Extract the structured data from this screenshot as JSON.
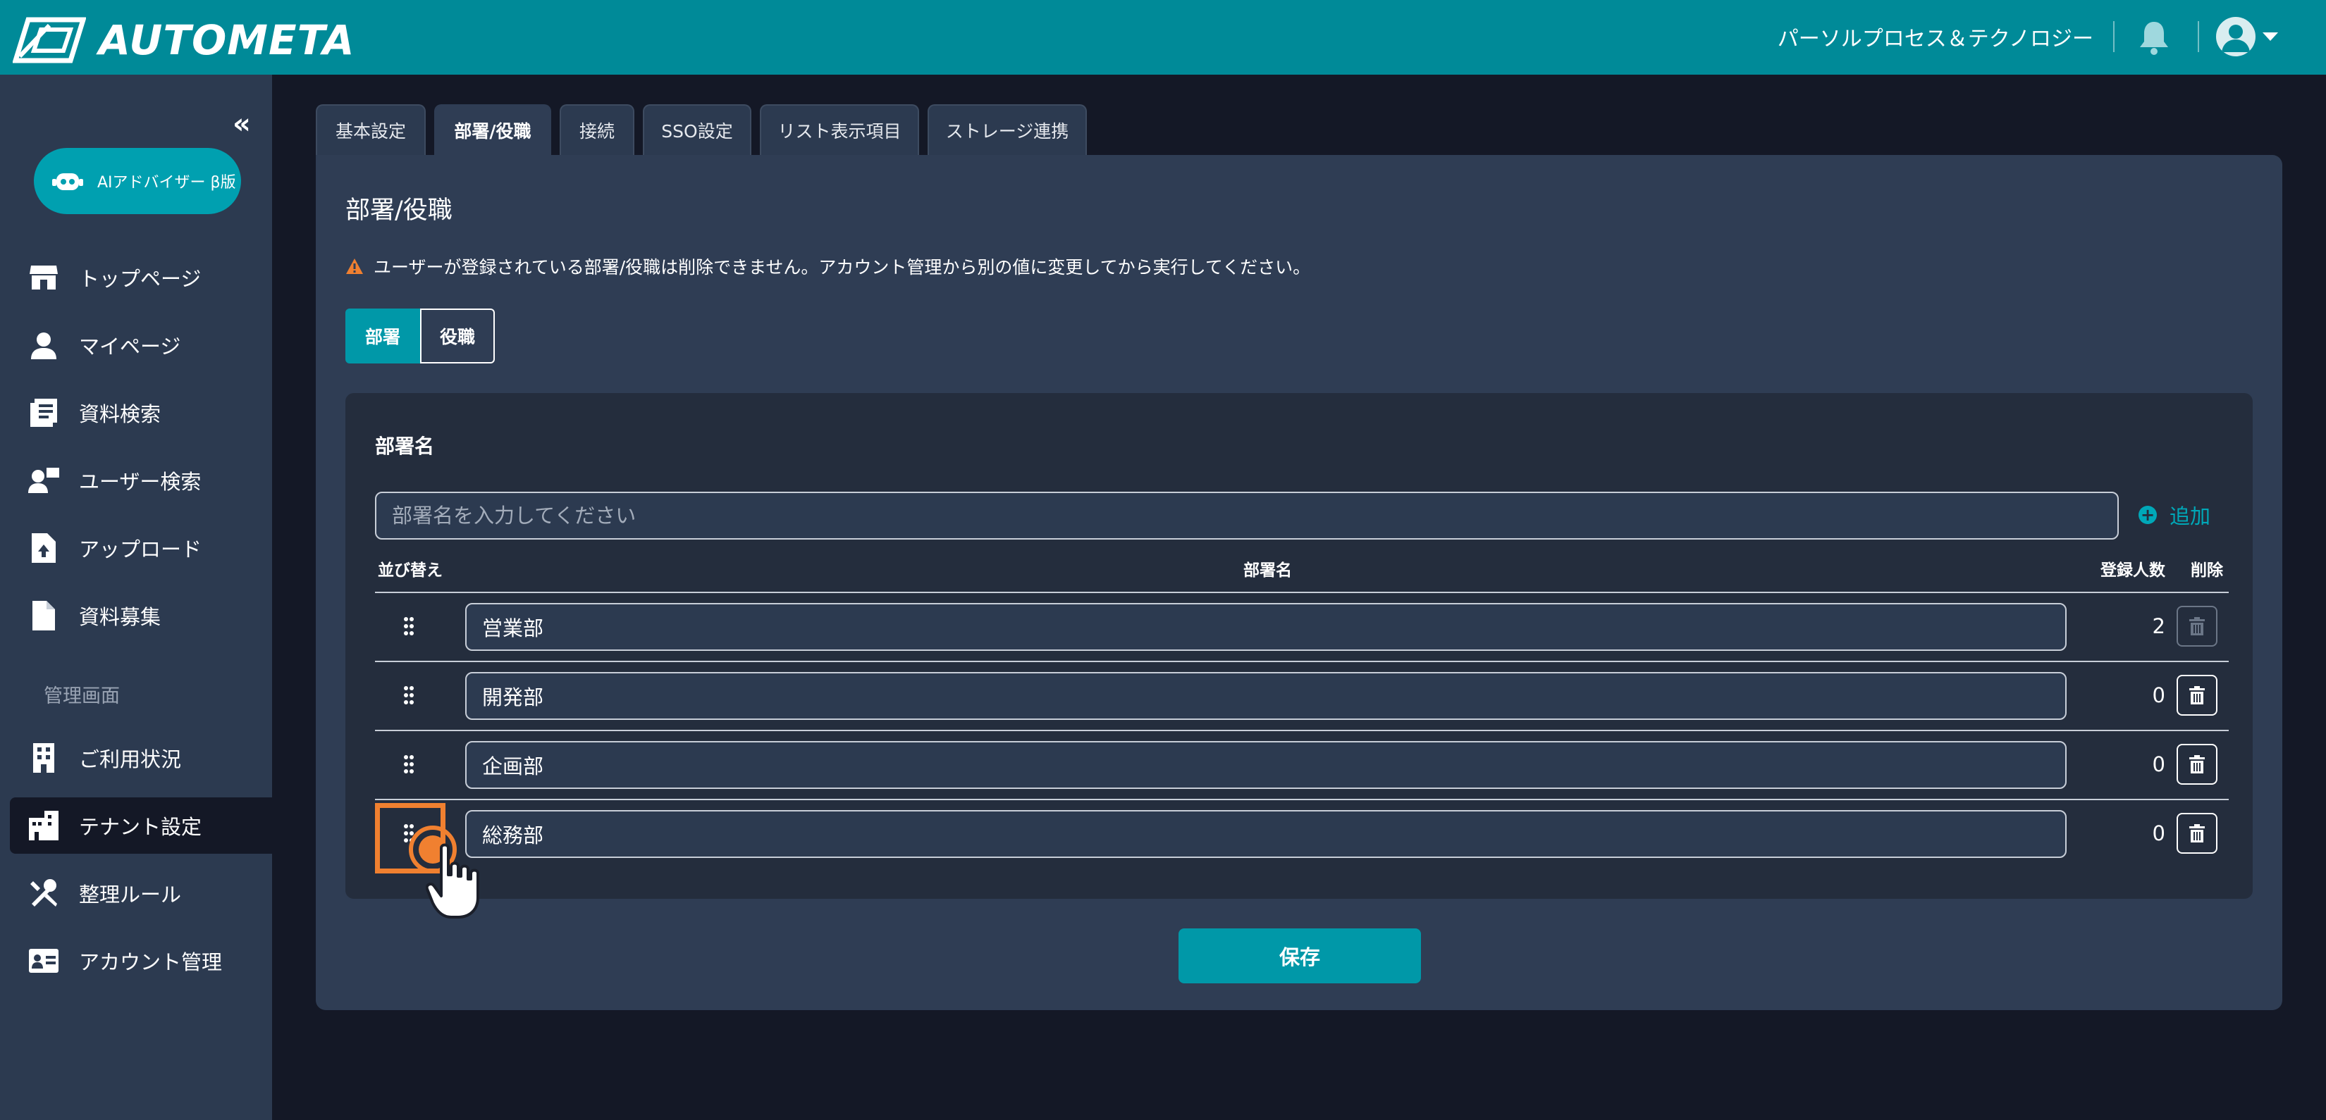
{
  "header": {
    "brand": "AUTOMETA",
    "org_name": "パーソルプロセス＆テクノロジー"
  },
  "sidebar": {
    "ai_button": "AIアドバイザー β版",
    "items": [
      {
        "label": "トップページ",
        "icon": "store-icon"
      },
      {
        "label": "マイページ",
        "icon": "person-icon"
      },
      {
        "label": "資料検索",
        "icon": "document-list-icon"
      },
      {
        "label": "ユーザー検索",
        "icon": "user-search-icon"
      },
      {
        "label": "アップロード",
        "icon": "file-upload-icon"
      },
      {
        "label": "資料募集",
        "icon": "file-icon"
      }
    ],
    "admin_section_title": "管理画面",
    "admin_items": [
      {
        "label": "ご利用状況",
        "icon": "building-icon"
      },
      {
        "label": "テナント設定",
        "icon": "tenant-icon",
        "active": true
      },
      {
        "label": "整理ルール",
        "icon": "tools-icon"
      },
      {
        "label": "アカウント管理",
        "icon": "id-card-icon"
      }
    ]
  },
  "tabs": [
    {
      "label": "基本設定"
    },
    {
      "label": "部署/役職",
      "active": true
    },
    {
      "label": "接続"
    },
    {
      "label": "SSO設定"
    },
    {
      "label": "リスト表示項目"
    },
    {
      "label": "ストレージ連携"
    }
  ],
  "main": {
    "title": "部署/役職",
    "warning": "ユーザーが登録されている部署/役職は削除できません。アカウント管理から別の値に変更してから実行してください。",
    "segments": [
      {
        "label": "部署",
        "active": true
      },
      {
        "label": "役職",
        "active": false
      }
    ],
    "card": {
      "label": "部署名",
      "input_placeholder": "部署名を入力してください",
      "add_label": "追加",
      "columns": {
        "sort": "並び替え",
        "name": "部署名",
        "count": "登録人数",
        "delete": "削除"
      },
      "rows": [
        {
          "name": "営業部",
          "count": "2",
          "deletable": false
        },
        {
          "name": "開発部",
          "count": "0",
          "deletable": true
        },
        {
          "name": "企画部",
          "count": "0",
          "deletable": true
        },
        {
          "name": "総務部",
          "count": "0",
          "deletable": true
        }
      ]
    },
    "save_label": "保存"
  },
  "colors": {
    "header_bg": "#008a98",
    "accent": "#0098a8",
    "sidebar_bg": "#2c3a50",
    "panel_bg": "#2f3d54",
    "card_bg": "#242d3d",
    "page_bg": "#141826",
    "highlight": "#f08030",
    "warning": "#f08030"
  }
}
